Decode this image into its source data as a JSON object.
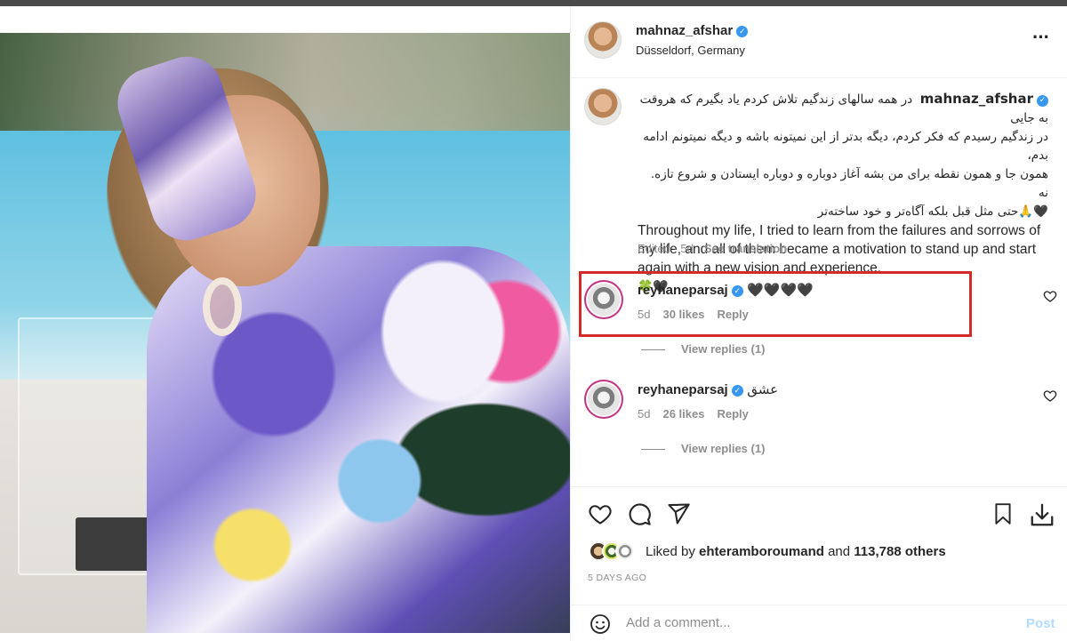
{
  "post": {
    "author": "mahnaz_afshar",
    "location": "Düsseldorf, Germany",
    "caption_fa_lines": [
      "در همه سالهای زندگیم تلاش کردم یاد بگیرم که هروقت به جایی",
      "در زندگیم رسیدم که فکر کردم، دیگه بدتر از این نمیتونه باشه و دیگه نمیتونم ادامه بدم،",
      "همون جا و همون نقطه برای من بشه آغاز دوباره و دوباره ایستادن و شروع تازه. نه",
      "حتی مثل قبل بلکه آگاه‌تر و خود ساخته‌تر"
    ],
    "caption_en": "Throughout my life, I tried to learn from the failures and sorrows of my life, and all of them became a motivation to stand up and start again with a new vision and experience.",
    "caption_emoji": "🍀🖤",
    "caption_fa_emoji": "🖤🙏",
    "edited_label": "Edited · 5d",
    "see_translation": "See translation",
    "likes_prefix": "Liked by",
    "likes_user": "ehteramboroumand",
    "likes_and": "and",
    "likes_others": "113,788 others",
    "time_ago": "5 DAYS AGO"
  },
  "comments": [
    {
      "user": "reyhaneparsaj",
      "text": "🖤🖤🖤🖤",
      "age": "5d",
      "likes": "30 likes",
      "reply": "Reply",
      "view_replies": "View replies (1)"
    },
    {
      "user": "reyhaneparsaj",
      "text": "عشق",
      "age": "5d",
      "likes": "26 likes",
      "reply": "Reply",
      "view_replies": "View replies (1)"
    }
  ],
  "add_comment": {
    "placeholder": "Add a comment...",
    "post_label": "Post"
  },
  "icons": {
    "more": "more-options-icon",
    "like": "heart-icon",
    "comment": "comment-icon",
    "share": "share-icon",
    "save": "bookmark-icon",
    "download": "download-icon",
    "emoji": "emoji-icon",
    "verified": "verified-badge-icon"
  },
  "colors": {
    "verified": "#3897f0",
    "highlight_box": "#d52a2a",
    "muted_text": "#8e8e8e",
    "post_button_disabled": "#b3dbff",
    "story_ring": "#c13584"
  }
}
